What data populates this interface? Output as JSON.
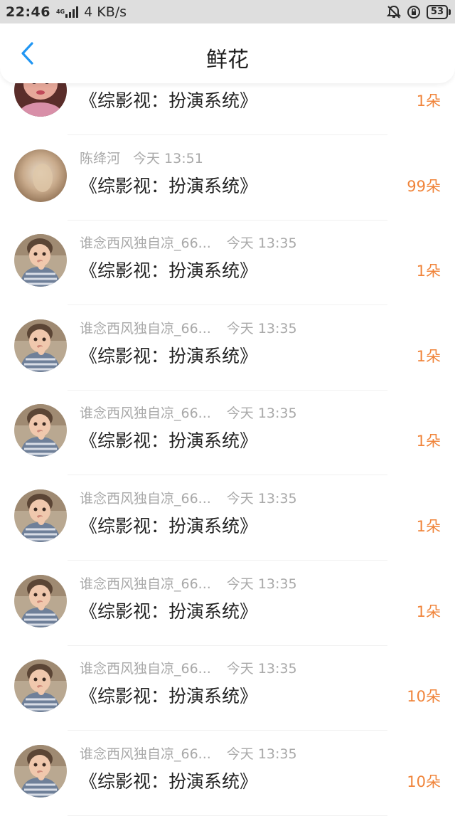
{
  "status_bar": {
    "time": "22:46",
    "network_tag": "4G",
    "speed": "4 KB/s",
    "battery": "53",
    "icons": [
      "network-signal-icon",
      "mute-bell-icon",
      "lock-rotation-icon",
      "battery-icon"
    ]
  },
  "header": {
    "title": "鲜花",
    "back_icon": "chevron-left-icon",
    "accent_color": "#2196f3"
  },
  "colors": {
    "amount": "#f0843a",
    "meta": "#a9a9a9",
    "text": "#222222"
  },
  "rows": [
    {
      "user": "",
      "time": "",
      "book": "《综影视：扮演系统》",
      "amount": "1朵",
      "avatar": "girl-avatar"
    },
    {
      "user": "陈绛河",
      "time": "今天 13:51",
      "book": "《综影视：扮演系统》",
      "amount": "99朵",
      "avatar": "blur-avatar"
    },
    {
      "user": "谁念西风独自凉_66...",
      "time": "今天 13:35",
      "book": "《综影视：扮演系统》",
      "amount": "1朵",
      "avatar": "child-avatar"
    },
    {
      "user": "谁念西风独自凉_66...",
      "time": "今天 13:35",
      "book": "《综影视：扮演系统》",
      "amount": "1朵",
      "avatar": "child-avatar"
    },
    {
      "user": "谁念西风独自凉_66...",
      "time": "今天 13:35",
      "book": "《综影视：扮演系统》",
      "amount": "1朵",
      "avatar": "child-avatar"
    },
    {
      "user": "谁念西风独自凉_66...",
      "time": "今天 13:35",
      "book": "《综影视：扮演系统》",
      "amount": "1朵",
      "avatar": "child-avatar"
    },
    {
      "user": "谁念西风独自凉_66...",
      "time": "今天 13:35",
      "book": "《综影视：扮演系统》",
      "amount": "1朵",
      "avatar": "child-avatar"
    },
    {
      "user": "谁念西风独自凉_66...",
      "time": "今天 13:35",
      "book": "《综影视：扮演系统》",
      "amount": "10朵",
      "avatar": "child-avatar"
    },
    {
      "user": "谁念西风独自凉_66...",
      "time": "今天 13:35",
      "book": "《综影视：扮演系统》",
      "amount": "10朵",
      "avatar": "child-avatar"
    }
  ]
}
